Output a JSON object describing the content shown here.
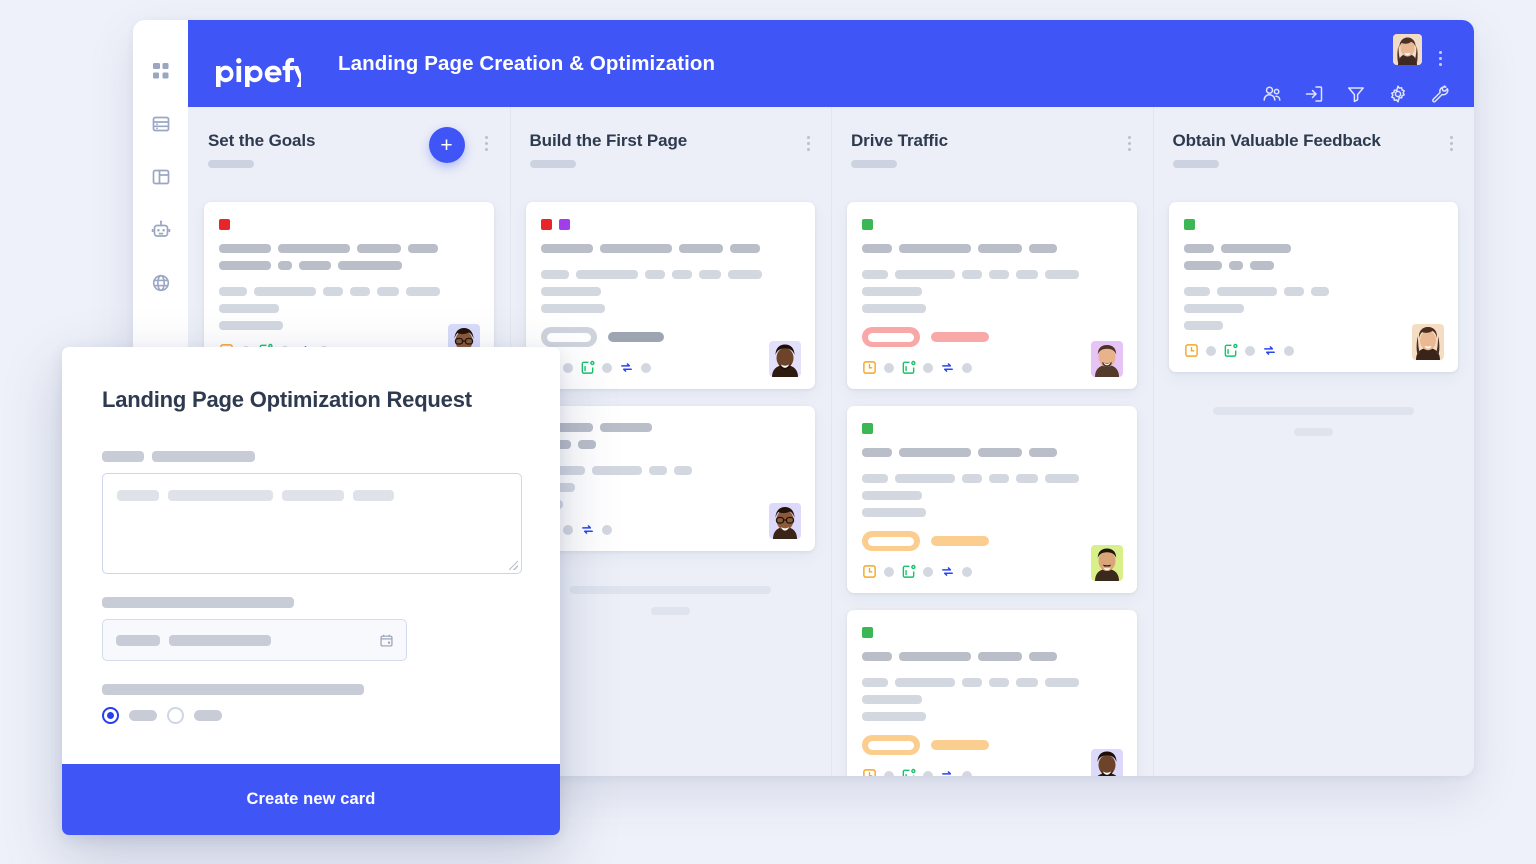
{
  "app": {
    "brand": "pipefy",
    "board_title": "Landing Page Creation & Optimization",
    "accent": "#4055f5",
    "background": "#eef1f9"
  },
  "sidebar": {
    "items": [
      {
        "icon": "apps-grid-icon",
        "name": "sidebar-item-apps"
      },
      {
        "icon": "database-icon",
        "name": "sidebar-item-database"
      },
      {
        "icon": "layout-icon",
        "name": "sidebar-item-layout"
      },
      {
        "icon": "robot-icon",
        "name": "sidebar-item-automation"
      },
      {
        "icon": "globe-icon",
        "name": "sidebar-item-portal"
      }
    ]
  },
  "header": {
    "tools": [
      {
        "icon": "members-icon",
        "label": "Members"
      },
      {
        "icon": "import-icon",
        "label": "Import"
      },
      {
        "icon": "filter-icon",
        "label": "Filter"
      },
      {
        "icon": "gear-icon",
        "label": "Settings"
      },
      {
        "icon": "wrench-icon",
        "label": "Tools"
      }
    ],
    "avatar_alt": "user-avatar",
    "kebab_label": "More options"
  },
  "board": {
    "columns": [
      {
        "title": "Set the Goals",
        "has_add_button": true,
        "add_label": "+",
        "cards": [
          {
            "tags": [
              "#e8252a"
            ],
            "badge": null,
            "avatar_bg": "#d9dcfb",
            "avatar_skin": "#6d4a33"
          }
        ],
        "ghost_lines": false
      },
      {
        "title": "Build the First Page",
        "has_add_button": false,
        "add_label": "",
        "cards": [
          {
            "tags": [
              "#e8252a",
              "#a13dea"
            ],
            "badge": "#cfd3dc",
            "avatar_bg": "#e3e0fb",
            "avatar_skin": "#5e3a23"
          },
          {
            "tags": [],
            "badge": null,
            "avatar_bg": "#dcd9fb",
            "avatar_skin": "#6d4a33"
          }
        ],
        "ghost_lines": true
      },
      {
        "title": "Drive Traffic",
        "has_add_button": false,
        "add_label": "",
        "cards": [
          {
            "tags": [
              "#3cb755"
            ],
            "badge": "#f9a8a8",
            "avatar_bg": "#e6c4f5",
            "avatar_skin": "#c98c6a"
          },
          {
            "tags": [
              "#3cb755"
            ],
            "badge": "#fbcd8e",
            "avatar_bg": "#d9f08a",
            "avatar_skin": "#c08a5e"
          },
          {
            "tags": [
              "#3cb755"
            ],
            "badge": "#fbcd8e",
            "avatar_bg": "#dcd9fb",
            "avatar_skin": "#5e3a23"
          }
        ],
        "ghost_lines": false
      },
      {
        "title": "Obtain Valuable Feedback",
        "has_add_button": false,
        "add_label": "",
        "cards": [
          {
            "tags": [
              "#3cb755"
            ],
            "badge": null,
            "avatar_bg": "#f5ddc3",
            "avatar_skin": "#e0b18c",
            "short": true
          }
        ],
        "ghost_lines": true
      }
    ],
    "card_footer_icons": [
      {
        "icon": "clock-square-icon",
        "color": "#f5a623"
      },
      {
        "icon": "calendar-check-icon",
        "color": "#15c26b"
      },
      {
        "icon": "sync-arrows-icon",
        "color": "#2a45f0"
      }
    ]
  },
  "modal": {
    "title": "Landing Page Optimization Request",
    "fields": [
      {
        "type": "textarea",
        "name": "description-field"
      },
      {
        "type": "date",
        "name": "date-field",
        "icon": "calendar-icon"
      },
      {
        "type": "radio-group",
        "name": "choice-field",
        "selected_index": 0,
        "options_count": 2
      }
    ],
    "submit_label": "Create new card"
  }
}
